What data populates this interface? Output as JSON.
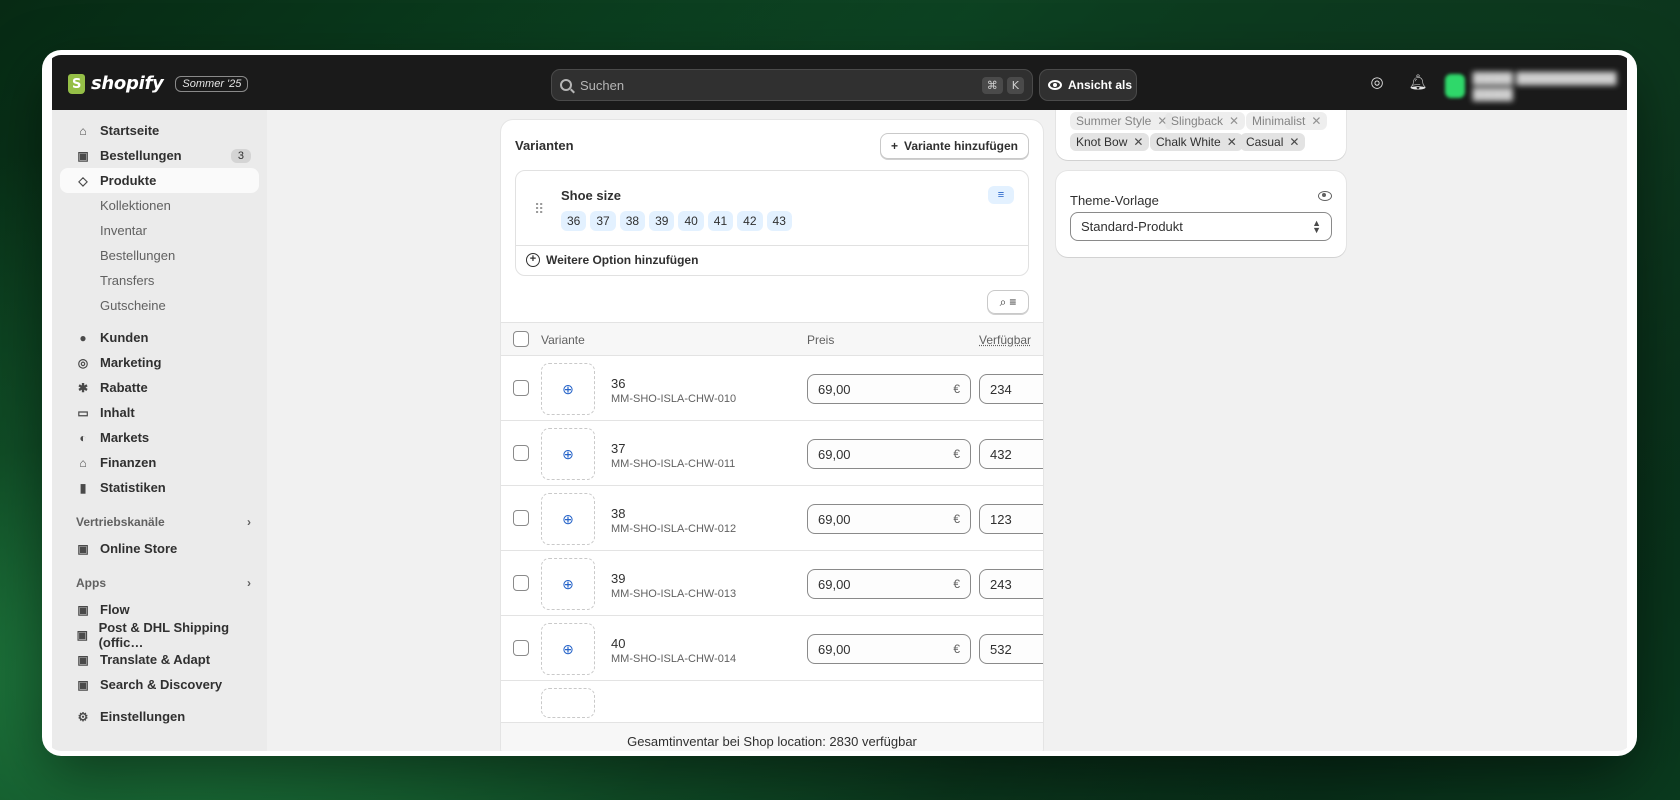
{
  "topbar": {
    "brand": "shopify",
    "edition": "Sommer '25",
    "search_placeholder": "Suchen",
    "shortcut_cmd": "⌘",
    "shortcut_key": "K",
    "view_as_label": "Ansicht als"
  },
  "sidebar": {
    "home": "Startseite",
    "orders": "Bestellungen",
    "orders_count": "3",
    "products": "Produkte",
    "product_subitems": [
      "Kollektionen",
      "Inventar",
      "Bestellungen",
      "Transfers",
      "Gutscheine"
    ],
    "customers": "Kunden",
    "marketing": "Marketing",
    "discounts": "Rabatte",
    "content": "Inhalt",
    "markets": "Markets",
    "finance": "Finanzen",
    "analytics": "Statistiken",
    "sales_channels_heading": "Vertriebskanäle",
    "online_store": "Online Store",
    "apps_heading": "Apps",
    "apps": [
      "Flow",
      "Post & DHL Shipping (offic…",
      "Translate & Adapt",
      "Search & Discovery"
    ],
    "settings": "Einstellungen"
  },
  "variants": {
    "title": "Varianten",
    "add_variant": "Variante hinzufügen",
    "option_name": "Shoe size",
    "option_values": [
      "36",
      "37",
      "38",
      "39",
      "40",
      "41",
      "42",
      "43"
    ],
    "add_option": "Weitere Option hinzufügen",
    "columns": {
      "variant": "Variante",
      "price": "Preis",
      "available": "Verfügbar"
    },
    "currency": "€",
    "rows": [
      {
        "name": "36",
        "sku": "MM-SHO-ISLA-CHW-010",
        "price": "69,00",
        "stock": "234"
      },
      {
        "name": "37",
        "sku": "MM-SHO-ISLA-CHW-011",
        "price": "69,00",
        "stock": "432"
      },
      {
        "name": "38",
        "sku": "MM-SHO-ISLA-CHW-012",
        "price": "69,00",
        "stock": "123"
      },
      {
        "name": "39",
        "sku": "MM-SHO-ISLA-CHW-013",
        "price": "69,00",
        "stock": "243"
      },
      {
        "name": "40",
        "sku": "MM-SHO-ISLA-CHW-014",
        "price": "69,00",
        "stock": "532"
      }
    ],
    "total_inventory": "Gesamtinventar bei Shop location: 2830 verfügbar"
  },
  "tags": {
    "row1": [
      "Summer Style",
      "Slingback",
      "Minimalist"
    ],
    "row2": [
      "Knot Bow",
      "Chalk White",
      "Casual"
    ]
  },
  "theme": {
    "label": "Theme-Vorlage",
    "selected": "Standard-Produkt"
  },
  "colors": {
    "accent": "#2fd86a",
    "chip_bg": "#e3f1ff",
    "topbar": "#1a1a1a"
  }
}
